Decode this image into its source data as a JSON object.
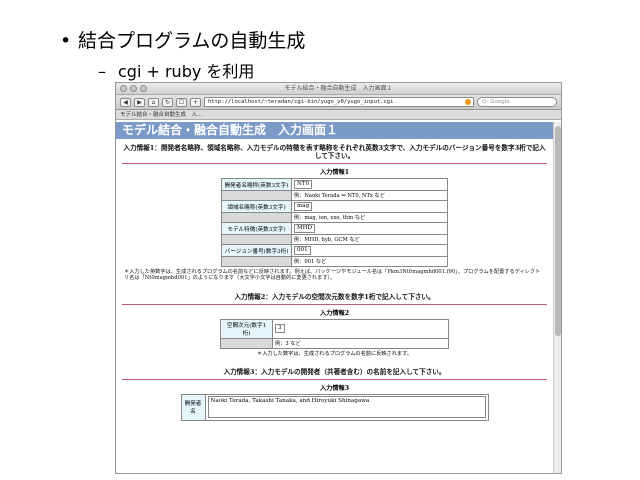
{
  "slide": {
    "bullet1": "結合プログラムの自動生成",
    "bullet2": "cgi + ruby を利用",
    "dot": "•",
    "dash": "–"
  },
  "browser": {
    "window_title": "モデル結合・融合自動生成　入力画面１",
    "url": "http://localhost/~teradan/cgi-bin/yugo_v0/yugo_input.cgi",
    "search_placeholder": "Q- Google",
    "tab_label": "モデル結合・融合自動生成　入..."
  },
  "page": {
    "header": "モデル結合・融合自動生成　入力画面１",
    "section1_title": "入力情報1：開発者名略称、領域名略称、入力モデルの特徴を表す略称をそれぞれ英数3文字で、入力モデルのバージョン番号を数字3桁で記入して下さい。",
    "form1_title": "入力情報1",
    "form1_rows": [
      {
        "label": "開発者名略称(英数3文字)",
        "value": "NT0",
        "example": "例：Naoki Terada ⇒ NT0, NTx など"
      },
      {
        "label": "領域名略称(英数3文字)",
        "value": "mag",
        "example": "例：mag, ion, exo, thm など"
      },
      {
        "label": "モデル特徴(英数3文字)",
        "value": "MHD",
        "example": "例：MHD, hyb, GCM など"
      },
      {
        "label": "バージョン番号(数字3桁)",
        "value": "001",
        "example": "例：001 など"
      }
    ],
    "note1": "＊入力した英数字は、生成されるプログラムの名前などに反映されます。例えば、パッケージやモジュール名は「Pkm3Nt0magmhd001.f90」、プログラムを配置するディレクトリ名は「Nt0magmhd001」のようになります（大文字小文字は自動的に変更されます）。",
    "section2_title": "入力情報2：入力モデルの空間次元数を数字1桁で記入して下さい。",
    "form2_title": "入力情報2",
    "form2_label": "空間次元(数字1桁)",
    "form2_value": "3",
    "form2_example": "例：3 など",
    "note2": "＊入力した数字は、生成されるプログラムの名前に反映されます。",
    "section3_title": "入力情報3：入力モデルの開発者（共著者含む）の名前を記入して下さい。",
    "form3_title": "入力情報3",
    "form3_label": "開発者名",
    "form3_value": "Naoki Terada, Takashi Tanaka, and Hiroyuki Shinagawa"
  }
}
